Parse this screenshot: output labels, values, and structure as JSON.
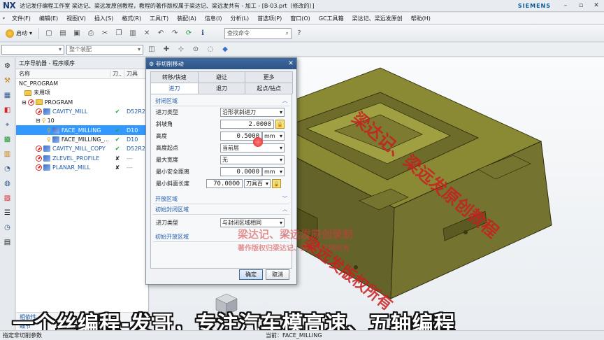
{
  "title_bar": {
    "app_logo": "NX",
    "title": "达记发仔编程工作室  梁达记、梁远发原创教程，教程的著作版权属于梁达记、梁远发共有 - 加工 - [B-03.prt（修改的）]",
    "brand": "SIEMENS"
  },
  "menu": {
    "items": [
      "文件(F)",
      "编辑(E)",
      "视图(V)",
      "插入(S)",
      "格式(R)",
      "工具(T)",
      "装配(A)",
      "信息(I)",
      "分析(L)",
      "首选项(P)",
      "窗口(O)",
      "GC工具箱",
      "梁达记、梁远发原创",
      "帮助(H)"
    ]
  },
  "toolbar": {
    "start_label": "启动",
    "search_placeholder": "查找命令"
  },
  "toolbar2": {
    "filter_value": "",
    "assembly_value": "整个装配"
  },
  "navigator": {
    "header": "工序导航器 - 程序顺序",
    "col_name": "名称",
    "col_check": "刀..",
    "col_tool": "刀具",
    "rows": [
      {
        "name": "NC_PROGRAM",
        "check": "",
        "tool": ""
      },
      {
        "name": "未用项",
        "check": "",
        "tool": ""
      },
      {
        "name": "PROGRAM",
        "check": "",
        "tool": ""
      },
      {
        "name": "CAVITY_MILL",
        "check": "✔",
        "tool": "D52R2"
      },
      {
        "name": "10",
        "check": "",
        "tool": ""
      },
      {
        "name": "FACE_MILLING",
        "check": "✔",
        "tool": "D10"
      },
      {
        "name": "FACE_MILLING_...",
        "check": "✔",
        "tool": "D10"
      },
      {
        "name": "CAVITY_MILL_COPY",
        "check": "✔",
        "tool": "D52R2"
      },
      {
        "name": "ZLEVEL_PROFILE",
        "check": "✘",
        "tool": "---"
      },
      {
        "name": "PLANAR_MILL",
        "check": "✘",
        "tool": "---"
      }
    ],
    "tab_dependencies": "相依性",
    "tab_details": "细节"
  },
  "dialog": {
    "title": "非切削移动",
    "tabs_row1": [
      "转移/快速",
      "避让",
      "更多"
    ],
    "tabs_row2": [
      "进刀",
      "退刀",
      "起点/钻点"
    ],
    "closed_area_header": "封闭区域",
    "fields": {
      "entry_type_label": "进刀类型",
      "entry_type_value": "沿形状斜进刀",
      "ramp_angle_label": "斜坡角",
      "ramp_angle_value": "2.0000",
      "height_label": "高度",
      "height_value": "0.5000",
      "height_unit": "mm",
      "height_from_label": "高度起点",
      "height_from_value": "当前层",
      "max_width_label": "最大宽度",
      "max_width_value": "无",
      "min_clearance_label": "最小安全距离",
      "min_clearance_value": "0.0000",
      "min_clearance_unit": "mm",
      "min_ramp_label": "最小斜面长度",
      "min_ramp_value": "70.0000",
      "min_ramp_unit": "刀具百"
    },
    "open_area_header": "开放区域",
    "init_closed_header": "初始封闭区域",
    "init_entry_type_label": "进刀类型",
    "init_entry_type_value": "与封闭区域相同",
    "init_open_header": "初始开放区域",
    "ok_label": "确定",
    "cancel_label": "取消"
  },
  "statusbar": {
    "left": "指定非切削参数",
    "mid": "当前：FACE_MILLING"
  },
  "overlay": {
    "caption": "一个丝编程-发哥，专注汽车模高速、五轴编程",
    "wm1": "梁达记、梁远发原创教程",
    "wm2": "梁达记、梁远发原创录制",
    "wm3": "著作版权归梁达记、梁远发共同所有",
    "wm4": "梁远发版权所有"
  },
  "colors": {
    "part": "#7b7a2e",
    "selection": "#3399ff",
    "dialog_title": "#2d5487"
  }
}
